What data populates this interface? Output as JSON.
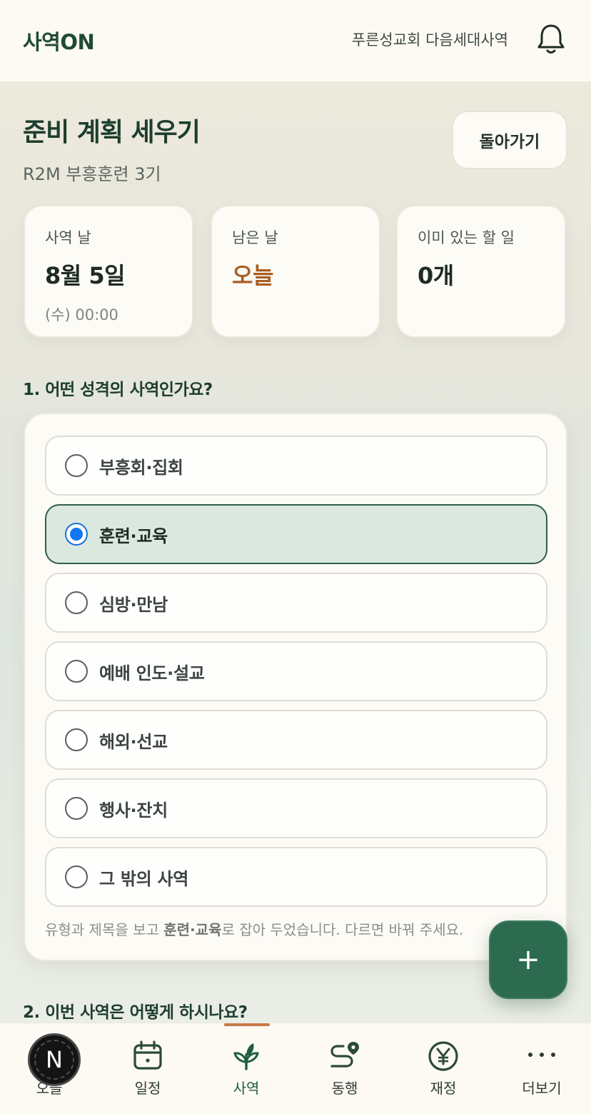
{
  "header": {
    "brand": "사역ON",
    "org": "푸른성교회 다음세대사역"
  },
  "page": {
    "title": "준비 계획 세우기",
    "subtitle": "R2M 부흥훈련 3기",
    "back_label": "돌아가기"
  },
  "stats": [
    {
      "label": "사역 날",
      "value": "8월 5일",
      "detail": "(수) 00:00"
    },
    {
      "label": "남은 날",
      "value": "오늘",
      "detail": ""
    },
    {
      "label": "이미 있는 할 일",
      "value": "0개",
      "detail": ""
    }
  ],
  "question1": {
    "title": "1. 어떤 성격의 사역인가요?",
    "options": [
      {
        "label": "부흥회·집회",
        "selected": false
      },
      {
        "label": "훈련·교육",
        "selected": true
      },
      {
        "label": "심방·만남",
        "selected": false
      },
      {
        "label": "예배 인도·설교",
        "selected": false
      },
      {
        "label": "해외·선교",
        "selected": false
      },
      {
        "label": "행사·잔치",
        "selected": false
      },
      {
        "label": "그 밖의 사역",
        "selected": false
      }
    ],
    "hint_before": "유형과 제목을 보고 ",
    "hint_bold": "훈련·교육",
    "hint_after": "로 잡아 두었습니다. 다르면 바꿔 주세요."
  },
  "question2": {
    "title": "2. 이번 사역은 어떻게 하시나요?"
  },
  "fab_label": "+",
  "badge_letter": "N",
  "tabs": [
    {
      "label": "오늘",
      "icon": "sun-icon",
      "active": false
    },
    {
      "label": "일정",
      "icon": "calendar-icon",
      "active": false
    },
    {
      "label": "사역",
      "icon": "sprout-icon",
      "active": true
    },
    {
      "label": "동행",
      "icon": "route-icon",
      "active": false
    },
    {
      "label": "재정",
      "icon": "won-coin-icon",
      "active": false
    },
    {
      "label": "더보기",
      "icon": "more-icon",
      "active": false
    }
  ],
  "colors": {
    "brand": "#1e4a36",
    "accent": "#a85e22",
    "primary": "#2d6b50",
    "selected_bg": "#dbe8df",
    "radio_selected": "#1277f3"
  }
}
